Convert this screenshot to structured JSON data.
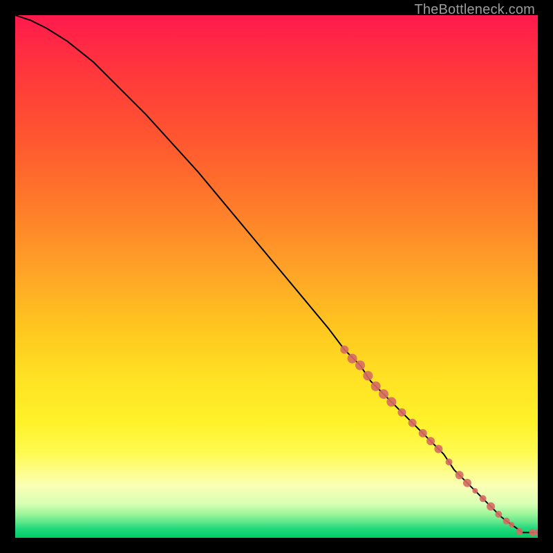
{
  "attribution": "TheBottleneck.com",
  "chart_data": {
    "type": "line",
    "title": "",
    "xlabel": "",
    "ylabel": "",
    "xlim": [
      0,
      100
    ],
    "ylim": [
      0,
      100
    ],
    "grid": false,
    "legend": false,
    "series": [
      {
        "name": "curve",
        "type": "line",
        "color": "#000000",
        "x": [
          0,
          3,
          6,
          10,
          15,
          20,
          25,
          30,
          35,
          40,
          45,
          50,
          55,
          60,
          63,
          66,
          68,
          70,
          72,
          74,
          76,
          78,
          80,
          82,
          84,
          85.5,
          87,
          88.5,
          90,
          91,
          92,
          93,
          94,
          95,
          96,
          96.5,
          97,
          100
        ],
        "y": [
          100,
          99,
          97.5,
          95,
          91,
          86,
          81,
          75.5,
          70,
          64,
          58,
          52,
          46,
          40,
          36,
          33,
          30,
          28,
          26,
          24,
          22,
          20,
          18,
          16,
          13,
          11.5,
          10,
          8.5,
          7,
          6,
          5,
          4,
          3.2,
          2.5,
          1.8,
          1.4,
          1.0,
          1.0
        ]
      },
      {
        "name": "cluster-points",
        "type": "scatter",
        "color": "#d66a62",
        "points": [
          {
            "x": 63.0,
            "y": 36.0,
            "r": 6
          },
          {
            "x": 64.5,
            "y": 34.3,
            "r": 7
          },
          {
            "x": 66.0,
            "y": 33.0,
            "r": 7
          },
          {
            "x": 67.5,
            "y": 31.0,
            "r": 7
          },
          {
            "x": 69.0,
            "y": 29.0,
            "r": 7
          },
          {
            "x": 70.5,
            "y": 27.5,
            "r": 7
          },
          {
            "x": 72.0,
            "y": 26.0,
            "r": 7
          },
          {
            "x": 74.0,
            "y": 24.0,
            "r": 6
          },
          {
            "x": 76.0,
            "y": 22.0,
            "r": 6
          },
          {
            "x": 78.0,
            "y": 20.0,
            "r": 6
          },
          {
            "x": 79.5,
            "y": 18.5,
            "r": 6
          },
          {
            "x": 81.0,
            "y": 17.0,
            "r": 6
          },
          {
            "x": 83.0,
            "y": 14.5,
            "r": 5
          },
          {
            "x": 85.0,
            "y": 12.0,
            "r": 6
          },
          {
            "x": 86.5,
            "y": 10.5,
            "r": 6
          },
          {
            "x": 88.0,
            "y": 9.0,
            "r": 4
          },
          {
            "x": 89.5,
            "y": 7.5,
            "r": 5
          },
          {
            "x": 91.0,
            "y": 6.0,
            "r": 6
          },
          {
            "x": 92.5,
            "y": 4.5,
            "r": 5
          },
          {
            "x": 94.0,
            "y": 3.2,
            "r": 5
          },
          {
            "x": 95.0,
            "y": 2.5,
            "r": 4
          },
          {
            "x": 96.5,
            "y": 1.2,
            "r": 5
          },
          {
            "x": 99.0,
            "y": 1.0,
            "r": 5
          },
          {
            "x": 100.0,
            "y": 1.0,
            "r": 5
          }
        ]
      }
    ]
  }
}
